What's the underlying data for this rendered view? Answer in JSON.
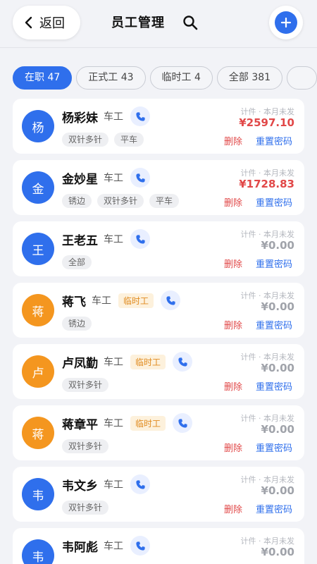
{
  "header": {
    "back_label": "返回",
    "title": "员工管理"
  },
  "tabs": [
    {
      "label": "在职 47"
    },
    {
      "label": "正式工 43"
    },
    {
      "label": "临时工 4"
    },
    {
      "label": "全部 381"
    }
  ],
  "colors": {
    "accent": "#2f6fec",
    "avatar_blue": "#2f6fec",
    "avatar_orange": "#f4961f",
    "danger": "#e14848"
  },
  "list": {
    "meta_label": "计件 · 本月未发",
    "delete_label": "删除",
    "reset_label": "重置密码",
    "employees": [
      {
        "initial": "杨",
        "name": "杨彩妹",
        "role": "车工",
        "badge": "",
        "tags": [
          "双针多针",
          "平车"
        ],
        "amount": "¥2597.10",
        "avatar_color": "#2f6fec",
        "amount_highlight": true
      },
      {
        "initial": "金",
        "name": "金妙星",
        "role": "车工",
        "badge": "",
        "tags": [
          "锈边",
          "双针多针",
          "平车"
        ],
        "amount": "¥1728.83",
        "avatar_color": "#2f6fec",
        "amount_highlight": true
      },
      {
        "initial": "王",
        "name": "王老五",
        "role": "车工",
        "badge": "",
        "tags": [
          "全部"
        ],
        "amount": "¥0.00",
        "avatar_color": "#2f6fec",
        "amount_highlight": false
      },
      {
        "initial": "蒋",
        "name": "蒋飞",
        "role": "车工",
        "badge": "临时工",
        "tags": [
          "锈边"
        ],
        "amount": "¥0.00",
        "avatar_color": "#f4961f",
        "amount_highlight": false
      },
      {
        "initial": "卢",
        "name": "卢凤勤",
        "role": "车工",
        "badge": "临时工",
        "tags": [
          "双针多针"
        ],
        "amount": "¥0.00",
        "avatar_color": "#f4961f",
        "amount_highlight": false
      },
      {
        "initial": "蒋",
        "name": "蒋章平",
        "role": "车工",
        "badge": "临时工",
        "tags": [
          "双针多针"
        ],
        "amount": "¥0.00",
        "avatar_color": "#f4961f",
        "amount_highlight": false
      },
      {
        "initial": "韦",
        "name": "韦文乡",
        "role": "车工",
        "badge": "",
        "tags": [
          "双针多针"
        ],
        "amount": "¥0.00",
        "avatar_color": "#2f6fec",
        "amount_highlight": false
      },
      {
        "initial": "韦",
        "name": "韦阿彪",
        "role": "车工",
        "badge": "",
        "tags": [],
        "amount": "¥0.00",
        "avatar_color": "#2f6fec",
        "amount_highlight": false
      }
    ]
  }
}
